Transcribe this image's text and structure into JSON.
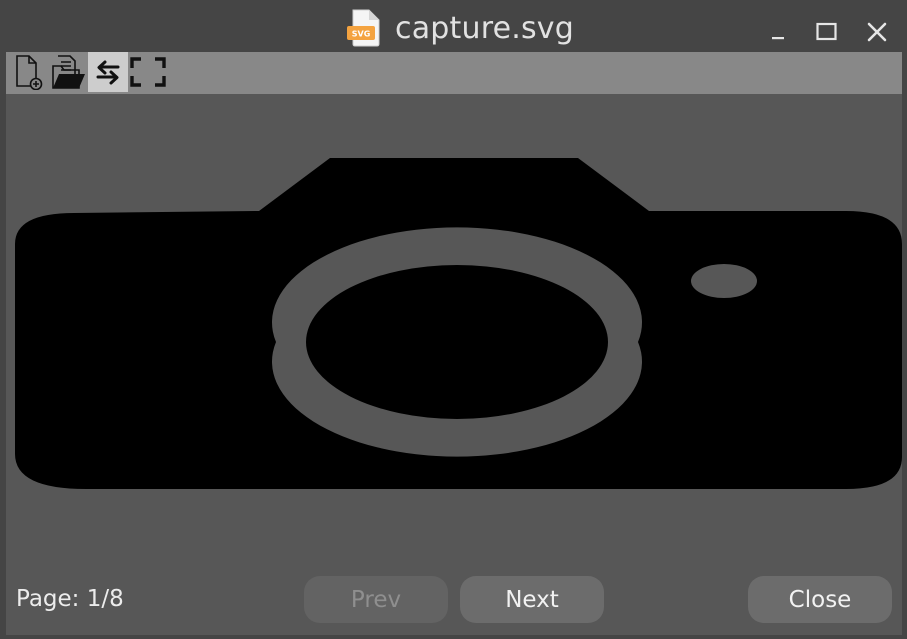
{
  "window": {
    "title": "capture.svg",
    "file_icon_badge": "SVG",
    "controls": [
      "minimize-icon",
      "maximize-icon",
      "close-icon"
    ]
  },
  "toolbar": {
    "tools": [
      {
        "icon": "new-file-icon",
        "active": false
      },
      {
        "icon": "open-folder-icon",
        "active": false
      },
      {
        "icon": "swap-arrows-icon",
        "active": true
      },
      {
        "icon": "fullscreen-icon",
        "active": false
      }
    ]
  },
  "preview": {
    "content": "camera-icon",
    "fill": "#000000"
  },
  "footer": {
    "page_label": "Page: 1/8",
    "prev_label": "Prev",
    "next_label": "Next",
    "close_label": "Close",
    "prev_enabled": false
  },
  "colors": {
    "background": "#454545",
    "toolbar": "#888888",
    "canvas": "#575757",
    "button": "#6c6c6c",
    "badge": "#f4a340"
  }
}
